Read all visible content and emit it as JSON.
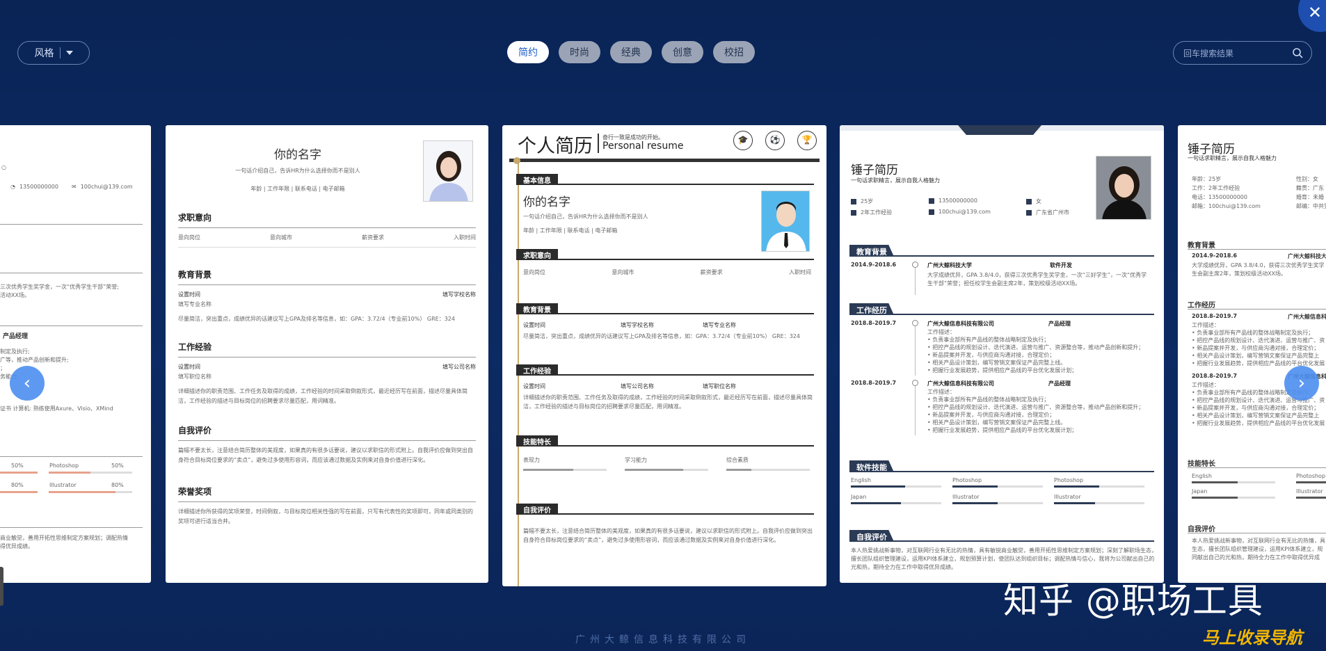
{
  "toolbar": {
    "style_label": "风格",
    "tabs": [
      "简约",
      "时尚",
      "经典",
      "创意",
      "校招"
    ],
    "active_tab": "简约",
    "search_placeholder": "回车搜索结果"
  },
  "card1": {
    "phone": "13500000000",
    "email": "100chui@139.com",
    "text1": "三次优秀学生奖学金，一次“优秀学生干部”荣誉;",
    "text2": "活动XX场。",
    "role": "产品经理",
    "lines": [
      "制定及执行;",
      "广等，推动产品创新和提升;",
      "；",
      "务能力;"
    ],
    "cert": "证书 计算机: 熟练使用Axure、Visio、XMind",
    "skills": [
      {
        "name": "Photoshop",
        "left_pct": "50%",
        "right_pct": "50%"
      },
      {
        "name": "Illustrator",
        "left_pct": "80%",
        "right_pct": "80%"
      }
    ],
    "bottom1": "商业触觉，善用开拓性思维制定方案规划；调配热情",
    "bottom2": "得优异成绩。"
  },
  "card2": {
    "name": "你的名字",
    "intro": "一句话介绍自己，告诉HR为什么选择你而不是别人",
    "meta": "年龄 | 工作年限 | 联系电话 | 电子邮箱",
    "job_title": "求职意向",
    "job_items": [
      "意向岗位",
      "意向城市",
      "薪资要求",
      "入职时间"
    ],
    "edu_title": "教育背景",
    "edu_time": "设置时间",
    "edu_school": "填写学校名称",
    "edu_major": "填写专业名称",
    "edu_desc": "尽量简洁，突出重点，成绩优异的话建议写上GPA及排名等信息，如：GPA：3.72/4（专业前10%） GRE：324",
    "work_title": "工作经验",
    "work_time": "设置时间",
    "work_company": "填写公司名称",
    "work_role": "填写职位名称",
    "work_desc1": "详细描述你的职责范围、工作任务及取得的成绩，工作经验的时间采取倒叙形式，最近经历写在前面，描述尽量具体简",
    "work_desc2": "洁，工作经验的描述与目标岗位的招聘要求尽量匹配，用词精准。",
    "eval_title": "自我评价",
    "eval_desc1": "篇幅不要太长，注意结合简历整体的美观度，如果真的有很多话要说，建议以求职信的形式附上。自我评价应做到突出自",
    "eval_desc2": "身符合目标岗位要求的“卖点”，避免过多使用形容词，而应该通过数据及实例来对自身价值进行深化。",
    "award_title": "荣誉奖项",
    "award_desc1": "详细描述你所获得的奖项荣誉，时间倒叙，与目标岗位相关性强的写在前面，只写有代表性的奖项即可，同年或同类别的",
    "award_desc2": "奖项可进行适当合并。"
  },
  "card3": {
    "title": "个人简历",
    "sub1": "奋行一致是成功的开始。",
    "sub2": "Personal resume",
    "icons": [
      "graduation-cap",
      "sports",
      "trophy"
    ],
    "basic_title": "基本信息",
    "name": "你的名字",
    "intro": "一句话介绍自己，告诉HR为什么选择你而不是别人",
    "meta": "年龄 | 工作年限 | 联系电话 | 电子邮箱",
    "job_title": "求职意向",
    "job_items": [
      "意向岗位",
      "意向城市",
      "薪资要求",
      "入职时间"
    ],
    "edu_title": "教育背景",
    "edu_cols": [
      "设置时间",
      "填写学校名称",
      "填写专业名称"
    ],
    "edu_desc": "尽量简洁，突出重点，成绩优异的话建议写上GPA及排名等信息，如：GPA：3.72/4（专业前10%） GRE：324",
    "work_title": "工作经验",
    "work_cols": [
      "设置时间",
      "填写公司名称",
      "填写职位名称"
    ],
    "work_desc1": "详细描述你的职责范围、工作任务及取得的成绩，工作经验的时间采取倒叙形式，最近经历写在前面，描述尽量具体简",
    "work_desc2": "洁，工作经验的描述与目标岗位的招聘要求尽量匹配，用词精准。",
    "skill_title": "技能特长",
    "skills": [
      {
        "name": "表现力",
        "fill": 0.6
      },
      {
        "name": "学习能力",
        "fill": 0.7
      },
      {
        "name": "综合素质",
        "fill": 0.3
      }
    ],
    "eval_title": "自我评价",
    "eval_desc1": "篇幅不要太长，注意结合简历整体的美观度，如果真的有很多话要说，建议以求职信的形式附上。自我评价应做到突出",
    "eval_desc2": "自身符合目标岗位要求的“卖点”，避免过多使用形容词，而应该通过数据及实例来对自身价值进行深化。"
  },
  "card4": {
    "title": "锤子简历",
    "subtitle": "一句话求职精言，展示自我人格魅力",
    "info": [
      "25岁",
      "13500000000",
      "女",
      "2年工作经验",
      "100chui@139.com",
      "广东省广州市"
    ],
    "edu_title": "教育背景",
    "edu_time": "2014.9-2018.6",
    "edu_school": "广州大鲸科技大学",
    "edu_major": "软件开发",
    "edu_desc1": "大学成绩优异，GPA 3.8/4.0，获得三次优秀学生奖学金，一次“三好学生”，一次“优秀学",
    "edu_desc2": "生干部”荣誉；担任校学生会副主席2年，策划校级活动XX场。",
    "work_title": "工作经历",
    "jobs": [
      {
        "time": "2018.8-2019.7",
        "company": "广州大鲸信息科技有限公司",
        "role": "产品经理",
        "lines": [
          "工作描述：",
          "• 负责事业部所有产品线的整体战略制定及执行；",
          "• 把控产品线的规划设计、迭代演进、运营与推广、资源整合等，推动产品创新和提升；",
          "• 新品提案并开发，与供应商沟通对接，合理定价；",
          "• 相关产品设计策划，编写营销文案保证产品完整上线。",
          "• 把握行业发展趋势，提供相应产品线的平台优化发展计划；"
        ]
      },
      {
        "time": "2018.8-2019.7",
        "company": "广州大鲸信息科技有限公司",
        "role": "产品经理",
        "lines": [
          "工作描述：",
          "• 负责事业部所有产品线的整体战略制定及执行；",
          "• 把控产品线的规划设计、迭代演进、运营与推广、资源整合等，推动产品创新和提升；",
          "• 新品提案并开发，与供应商沟通对接，合理定价；",
          "• 相关产品设计策划，编写营销文案保证产品完整上线。",
          "• 把握行业发展趋势，提供相应产品线的平台优化发展计划；"
        ]
      }
    ],
    "skill_title": "软件技能",
    "skills": [
      {
        "name": "English",
        "fill": 0.6
      },
      {
        "name": "Photoshop",
        "fill": 0.5
      },
      {
        "name": "Photoshop",
        "fill": 0.5
      },
      {
        "name": "Japan",
        "fill": 0.55
      },
      {
        "name": "Illustrator",
        "fill": 0.5
      },
      {
        "name": "Illustrator",
        "fill": 0.45
      }
    ],
    "eval_title": "自我评价",
    "eval_desc1": "本人热爱挑战新事物，对互联网行业有无比的热情，具有敏锐商业触觉，善用开拓性思维制定方案规划；深刻了解职场生态，",
    "eval_desc2": "擅长团队组织管理建设，运用KPI体系建立，规划预算计划，使团队达到组织目标；调配热情与信心，我将为公司献出自己的",
    "eval_desc3": "光和热，期待全力在工作中取得优异成绩。"
  },
  "card5": {
    "title": "锤子简历",
    "subtitle": "一句话求职精言，展示自我人格魅力",
    "info_left": [
      "年龄：25岁",
      "工作：2年工作经验",
      "电话：13500000000",
      "邮箱：100chui@139.com"
    ],
    "info_right": [
      "性别：女",
      "籍贯：广东",
      "婚育：未婚",
      "邮编：中共党"
    ],
    "edu_title": "教育背景",
    "edu_time": "2014.9-2018.6",
    "edu_school": "广州大鲸科技大",
    "edu_desc1": "大学成绩优异，GPA 3.8/4.0，获得三次优秀学生奖学",
    "edu_desc2": "生会副主席2年，策划校级活动XX场。",
    "work_title": "工作经历",
    "jobs": [
      {
        "time": "2018.8-2019.7",
        "company": "广州大鲸信息科",
        "lines": [
          "工作描述：",
          "• 负责事业部所有产品线的整体战略制定及执行；",
          "• 把控产品线的规划设计、迭代演进、运营与推广、资",
          "• 新品提案并开发，与供应商沟通对接，合理定价；",
          "• 相关产品设计策划，编写营销文案保证产品完整上",
          "• 把握行业发展趋势，提供相应产品线的平台优化发展"
        ]
      },
      {
        "time": "2018.8-2019.7",
        "company": "广州大鲸信息科",
        "lines": [
          "工作描述：",
          "• 负责事业部所有产品线的整体战略制定及执行；",
          "• 把控产品线的规划设计、迭代演进、运营与推广、资",
          "• 新品提案并开发，与供应商沟通对接，合理定价；",
          "• 相关产品设计策划，编写营销文案保证产品完整上",
          "• 把握行业发展趋势，提供相应产品线的平台优化发展"
        ]
      }
    ],
    "skill_title": "技能特长",
    "skills": [
      "English",
      "Photoshop",
      "Japan",
      "Illustrator"
    ],
    "eval_title": "自我评价",
    "eval_desc1": "本人热爱挑战新事物，对互联网行业有无比的热情，具",
    "eval_desc2": "生态，擅长团队组织管理建设，运用KPI体系建立，规",
    "eval_desc3": "同献出自己的光和热，期待全力在工作中取得优异成"
  },
  "watermark": "知乎 @职场工具",
  "watermark2": "马上收录导航",
  "footer": "广州大鲸信息科技有限公司",
  "colors": {
    "accent": "#1e5cc4",
    "bg": "#0a2456",
    "nav": "#4d8ff0"
  }
}
